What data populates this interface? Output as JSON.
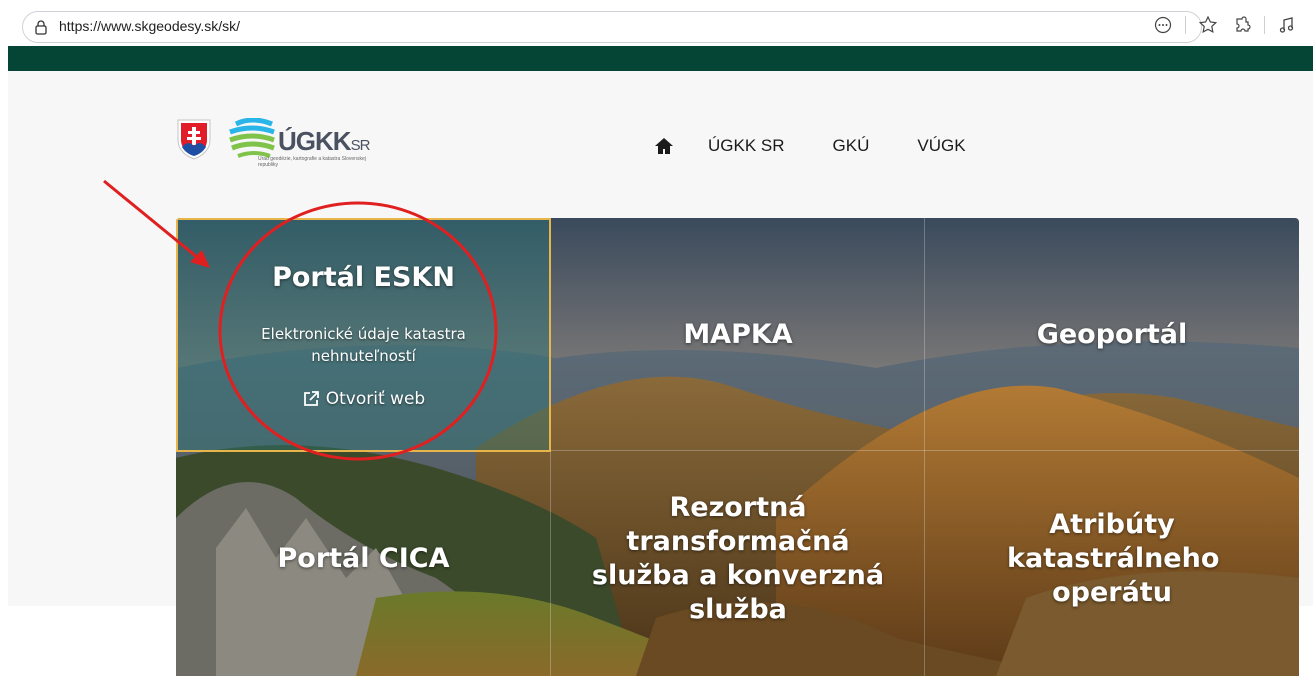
{
  "browser": {
    "url": "https://www.skgeodesy.sk/sk/",
    "icons": [
      "lock-icon",
      "more-icon",
      "favorite-star-icon",
      "extensions-icon",
      "reading-mode-icon"
    ]
  },
  "header": {
    "logo": {
      "name": "ÚGKK",
      "suffix": "SR",
      "subtitle": "Úrad geodézie, kartografie a katastra Slovenskej republiky"
    },
    "nav": [
      {
        "label": "ÚGKK SR"
      },
      {
        "label": "GKÚ"
      },
      {
        "label": "VÚGK"
      }
    ]
  },
  "tiles": [
    {
      "title": "Portál ESKN",
      "desc": "Elektronické údaje katastra nehnuteľností",
      "link": "Otvoriť web"
    },
    {
      "title": "MAPKA"
    },
    {
      "title": "Geoportál"
    },
    {
      "title": "Portál CICA"
    },
    {
      "title": "Rezortná transformačná služba a konverzná služba"
    },
    {
      "title": "Atribúty katastrálneho operátu"
    }
  ],
  "colors": {
    "header_green": "#044536",
    "highlight_border": "#e8b54a",
    "annotation_red": "#e02020"
  }
}
